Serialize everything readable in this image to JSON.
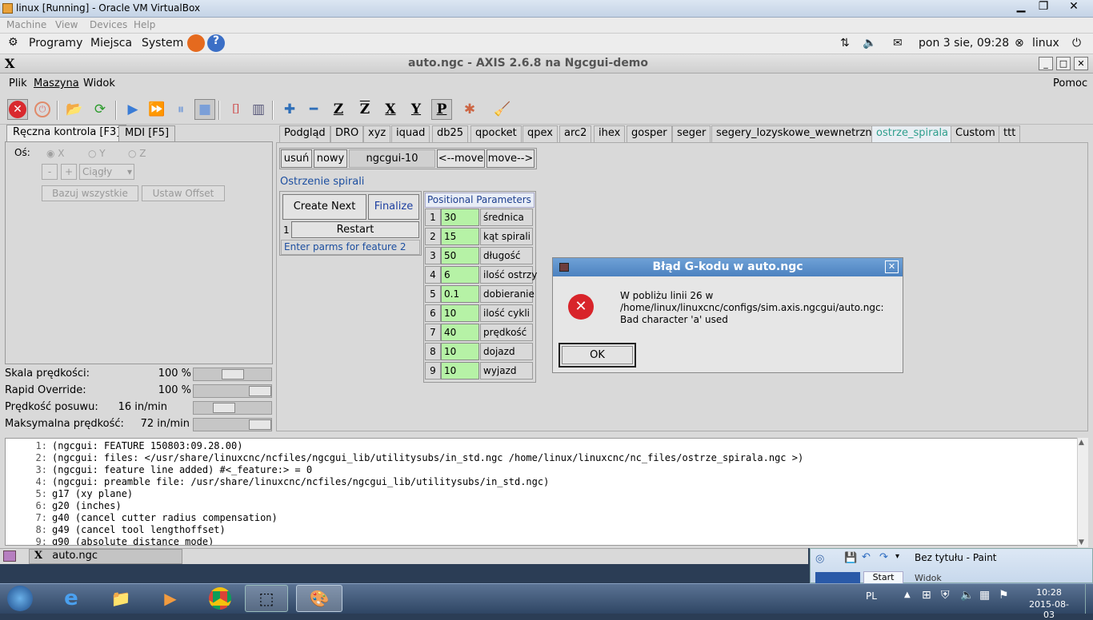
{
  "vbox": {
    "title": "linux [Running] - Oracle VM VirtualBox",
    "menu": [
      "Machine",
      "View",
      "Devices",
      "Help"
    ]
  },
  "gnome": {
    "programs": "Programy",
    "places": "Miejsca",
    "system": "System",
    "datetime": "pon  3 sie, 09:28",
    "user": "linux"
  },
  "axis": {
    "title": "auto.ngc - AXIS 2.6.8 na Ngcgui-demo",
    "menu": {
      "file": "Plik",
      "machine": "Maszyna",
      "view": "Widok",
      "help": "Pomoc"
    },
    "left_tabs": [
      "Ręczna kontrola [F3]",
      "MDI [F5]"
    ],
    "axis_label": "Oś:",
    "axes": [
      "X",
      "Y",
      "Z"
    ],
    "jog_minus": "-",
    "jog_plus": "+",
    "jog_mode": "Ciągły",
    "home_all": "Bazuj wszystkie",
    "set_offset": "Ustaw Offset",
    "sliders": [
      {
        "label": "Skala prędkości:",
        "value": "100 %",
        "level": 0.5
      },
      {
        "label": "Rapid Override:",
        "value": "100 %",
        "level": 1.0
      },
      {
        "label": "Prędkość posuwu:",
        "value": "16 in/min",
        "level": 0.22
      },
      {
        "label": "Maksymalna prędkość:",
        "value": "72 in/min",
        "level": 1.0
      }
    ],
    "right_tabs": [
      "Podgląd",
      "DRO",
      "xyz",
      "iquad",
      "db25",
      "qpocket",
      "qpex",
      "arc2",
      "ihex",
      "gosper",
      "seger",
      "segery_lozyskowe_wewnetrzne",
      "ostrze_spirala",
      "Custom",
      "ttt"
    ],
    "ngcgui": {
      "remove": "usuń",
      "new": "nowy",
      "name": "ngcgui-10",
      "move_left": "<--move",
      "move_right": "move-->",
      "feature_title": "Ostrzenie spirali",
      "create_next": "Create Next",
      "finalize": "Finalize",
      "count": "1",
      "restart": "Restart",
      "status": "Enter parms for feature 2",
      "params_header": "Positional Parameters",
      "params": [
        {
          "n": "1",
          "val": "30",
          "label": "średnica"
        },
        {
          "n": "2",
          "val": "15",
          "label": "kąt spirali"
        },
        {
          "n": "3",
          "val": "50",
          "label": "długość"
        },
        {
          "n": "4",
          "val": "6",
          "label": "ilość ostrzy"
        },
        {
          "n": "5",
          "val": "0.1",
          "label": "dobieranie"
        },
        {
          "n": "6",
          "val": "10",
          "label": "ilość cykli"
        },
        {
          "n": "7",
          "val": "40",
          "label": "prędkość"
        },
        {
          "n": "8",
          "val": "10",
          "label": "dojazd"
        },
        {
          "n": "9",
          "val": "10",
          "label": "wyjazd"
        }
      ]
    },
    "code": [
      {
        "n": "1:",
        "t": "(ngcgui: FEATURE 150803:09.28.00)"
      },
      {
        "n": "2:",
        "t": "(ngcgui: files: </usr/share/linuxcnc/ncfiles/ngcgui_lib/utilitysubs/in_std.ngc /home/linux/linuxcnc/nc_files/ostrze_spirala.ngc >)"
      },
      {
        "n": "3:",
        "t": "(ngcgui: feature line added) #<_feature:> = 0"
      },
      {
        "n": "4:",
        "t": "(ngcgui: preamble file: /usr/share/linuxcnc/ncfiles/ngcgui_lib/utilitysubs/in_std.ngc)"
      },
      {
        "n": "5:",
        "t": "g17 (xy plane)"
      },
      {
        "n": "6:",
        "t": "g20 (inches)"
      },
      {
        "n": "7:",
        "t": "g40 (cancel cutter radius compensation)"
      },
      {
        "n": "8:",
        "t": "g49 (cancel tool lengthoffset)"
      },
      {
        "n": "9:",
        "t": "g90 (absolute distance mode)"
      }
    ],
    "taskbar_item": "auto.ngc"
  },
  "dialog": {
    "title": "Błąd G-kodu w auto.ngc",
    "line1": "W pobliżu linii 26 w",
    "line2": "/home/linux/linuxcnc/configs/sim.axis.ngcgui/auto.ngc:",
    "line3": "Bad character 'a' used",
    "ok": "OK"
  },
  "paint": {
    "title": "Bez tytułu - Paint",
    "tab_start": "Start",
    "tab_view": "Widok"
  },
  "windows": {
    "lang": "PL",
    "time": "10:28",
    "date": "2015-08-03"
  },
  "colors": {
    "active_tab": "#2e9e8d",
    "param_field": "#b6f2a6",
    "dialog_header": "#4c82c0"
  }
}
